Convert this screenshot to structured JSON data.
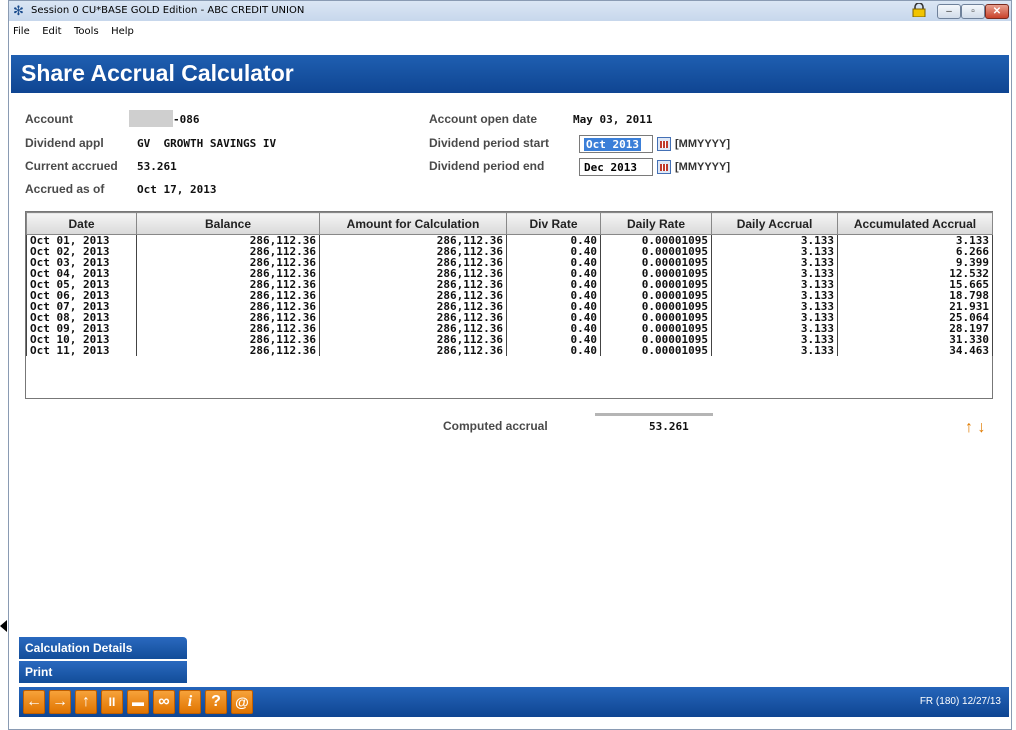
{
  "window": {
    "title": "Session 0 CU*BASE GOLD Edition - ABC CREDIT UNION"
  },
  "menu": [
    "File",
    "Edit",
    "Tools",
    "Help"
  ],
  "page_title": "Share Accrual Calculator",
  "fields": {
    "account_label": "Account",
    "account_value": "-086",
    "dividend_appl_label": "Dividend appl",
    "dividend_appl_value": "GV  GROWTH SAVINGS IV",
    "current_accrued_label": "Current accrued",
    "current_accrued_value": "53.261",
    "accrued_as_of_label": "Accrued as of",
    "accrued_as_of_value": "Oct 17, 2013",
    "open_date_label": "Account open date",
    "open_date_value": "May 03, 2011",
    "period_start_label": "Dividend period start",
    "period_start_value": "Oct 2013",
    "period_end_label": "Dividend period end",
    "period_end_value": "Dec 2013",
    "format_hint": "[MMYYYY]"
  },
  "table": {
    "headers": [
      "Date",
      "Balance",
      "Amount for Calculation",
      "Div Rate",
      "Daily Rate",
      "Daily Accrual",
      "Accumulated Accrual"
    ],
    "rows": [
      [
        "Oct 01, 2013",
        "286,112.36",
        "286,112.36",
        "0.40",
        "0.00001095",
        "3.133",
        "3.133"
      ],
      [
        "Oct 02, 2013",
        "286,112.36",
        "286,112.36",
        "0.40",
        "0.00001095",
        "3.133",
        "6.266"
      ],
      [
        "Oct 03, 2013",
        "286,112.36",
        "286,112.36",
        "0.40",
        "0.00001095",
        "3.133",
        "9.399"
      ],
      [
        "Oct 04, 2013",
        "286,112.36",
        "286,112.36",
        "0.40",
        "0.00001095",
        "3.133",
        "12.532"
      ],
      [
        "Oct 05, 2013",
        "286,112.36",
        "286,112.36",
        "0.40",
        "0.00001095",
        "3.133",
        "15.665"
      ],
      [
        "Oct 06, 2013",
        "286,112.36",
        "286,112.36",
        "0.40",
        "0.00001095",
        "3.133",
        "18.798"
      ],
      [
        "Oct 07, 2013",
        "286,112.36",
        "286,112.36",
        "0.40",
        "0.00001095",
        "3.133",
        "21.931"
      ],
      [
        "Oct 08, 2013",
        "286,112.36",
        "286,112.36",
        "0.40",
        "0.00001095",
        "3.133",
        "25.064"
      ],
      [
        "Oct 09, 2013",
        "286,112.36",
        "286,112.36",
        "0.40",
        "0.00001095",
        "3.133",
        "28.197"
      ],
      [
        "Oct 10, 2013",
        "286,112.36",
        "286,112.36",
        "0.40",
        "0.00001095",
        "3.133",
        "31.330"
      ],
      [
        "Oct 11, 2013",
        "286,112.36",
        "286,112.36",
        "0.40",
        "0.00001095",
        "3.133",
        "34.463"
      ]
    ]
  },
  "computed": {
    "label": "Computed accrual",
    "value": "53.261"
  },
  "scroll": {
    "up": "↑",
    "down": "↓"
  },
  "actions": {
    "calc_details": "Calculation Details",
    "print": "Print"
  },
  "toolbar": {
    "buttons": [
      "←",
      "→",
      "↑",
      "II",
      "▬",
      "∞",
      "i",
      "?",
      "@"
    ],
    "screen_code": "FR (180) 12/27/13"
  },
  "colors": {
    "header_blue": "#1752a3",
    "accent_orange": "#e87c00"
  }
}
